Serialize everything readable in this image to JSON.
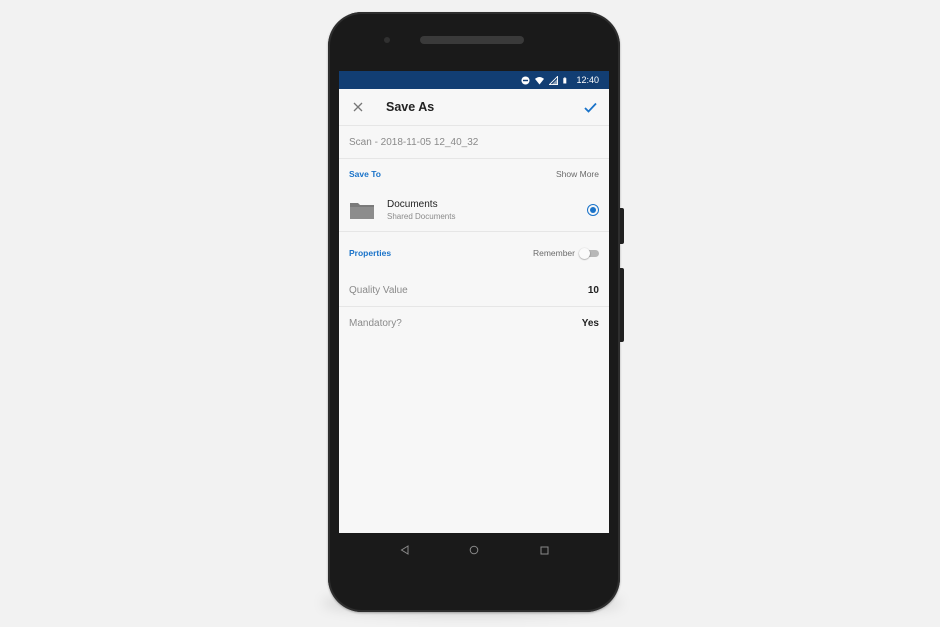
{
  "status_bar": {
    "time": "12:40",
    "icons": [
      "do-not-disturb-icon",
      "wifi-icon",
      "signal-icon",
      "battery-icon"
    ]
  },
  "header": {
    "title": "Save As",
    "close_icon": "close-icon",
    "confirm_icon": "checkmark-icon"
  },
  "filename": {
    "value": "Scan - 2018-11-05 12_40_32"
  },
  "save_to": {
    "label": "Save To",
    "show_more_label": "Show More",
    "location": {
      "name": "Documents",
      "subtitle": "Shared Documents",
      "selected": true,
      "icon": "folder-icon"
    }
  },
  "properties": {
    "label": "Properties",
    "remember_label": "Remember",
    "remember_on": false,
    "items": [
      {
        "label": "Quality Value",
        "value": "10"
      },
      {
        "label": "Mandatory?",
        "value": "Yes"
      }
    ]
  },
  "nav": {
    "icons": [
      "back-icon",
      "home-icon",
      "recents-icon"
    ]
  },
  "colors": {
    "status_bar": "#123e73",
    "accent": "#1a73c9"
  }
}
